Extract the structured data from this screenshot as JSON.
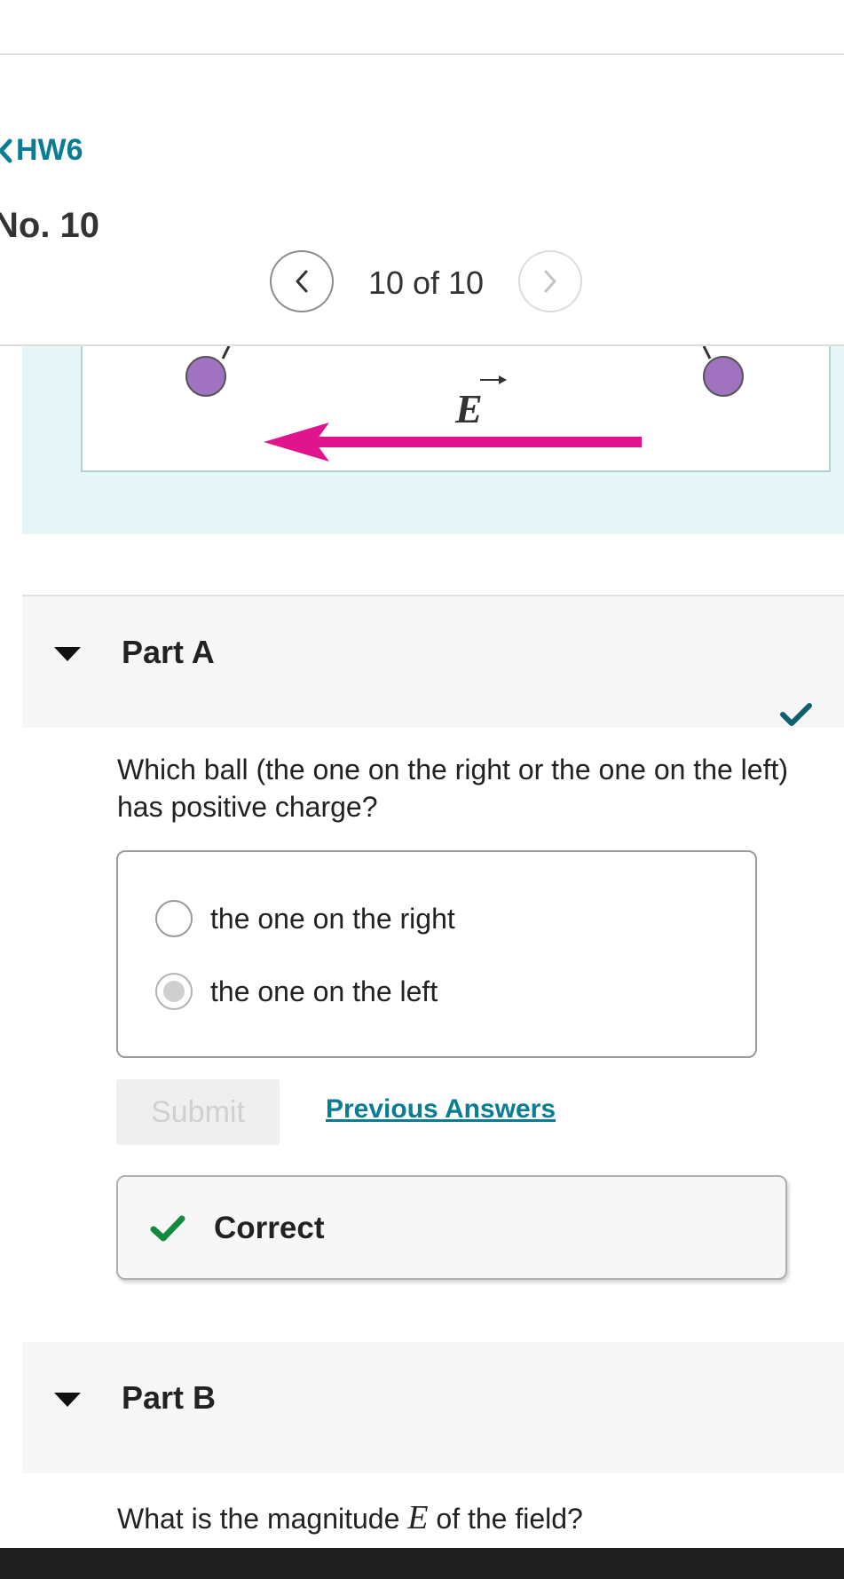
{
  "nav": {
    "back_label": "HW6",
    "item_title": "No. 10",
    "pager_label": "10 of 10"
  },
  "figure": {
    "field_label": "E",
    "arrow_color": "#e0148c",
    "ball_color": "#a072bf"
  },
  "part_a": {
    "title": "Part A",
    "status": "correct",
    "question": "Which ball (the one on the right or the one on the left) has positive charge?",
    "choices": [
      {
        "label": "the one on the right",
        "selected": false
      },
      {
        "label": "the one on the left",
        "selected": true
      }
    ],
    "submit_label": "Submit",
    "previous_answers_label": "Previous Answers",
    "feedback_label": "Correct"
  },
  "part_b": {
    "title": "Part B",
    "question_before": "What is the magnitude ",
    "question_var": "E",
    "question_after": " of the field?"
  },
  "colors": {
    "accent": "#0a7d94",
    "success": "#138a3d",
    "check_dark": "#0f5f74"
  },
  "icons": {
    "back": "chevron-left-icon",
    "prev": "chevron-left-icon",
    "next": "chevron-right-icon",
    "expand": "caret-down-icon",
    "status": "checkmark-icon"
  }
}
